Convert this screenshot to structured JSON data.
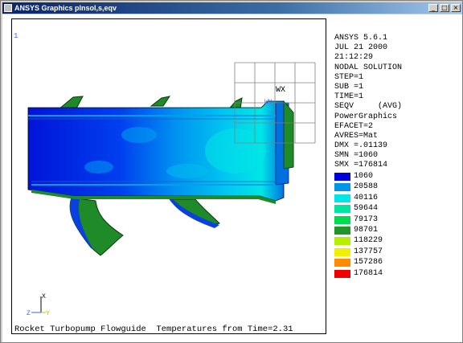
{
  "window": {
    "title": "ANSYS Graphics   plnsol,s,eqv",
    "buttons": {
      "minimize": "_",
      "maximize": "□",
      "close": "×"
    }
  },
  "viewport": {
    "window_number": "1",
    "caption": "Rocket Turbopump Flowguide  Temperatures from Time=2.31",
    "workplane_label": "WX",
    "workplane_label2": "WY"
  },
  "info": [
    "ANSYS 5.6.1",
    "JUL 21 2000",
    "21:12:29",
    "NODAL SOLUTION",
    "STEP=1",
    "SUB =1",
    "TIME=1",
    "SEQV     (AVG)",
    "PowerGraphics",
    "EFACET=2",
    "AVRES=Mat",
    "DMX =.01139",
    "SMN =1060",
    "SMX =176814"
  ],
  "legend": [
    {
      "value": "1060",
      "color": "#0000dc"
    },
    {
      "value": "20588",
      "color": "#0096e6"
    },
    {
      "value": "40116",
      "color": "#00e6e6"
    },
    {
      "value": "59644",
      "color": "#00e6a0"
    },
    {
      "value": "79173",
      "color": "#00dc50"
    },
    {
      "value": "98701",
      "color": "#1e9628"
    },
    {
      "value": "118229",
      "color": "#b4f000"
    },
    {
      "value": "137757",
      "color": "#f0f000"
    },
    {
      "value": "157286",
      "color": "#ff8c00"
    },
    {
      "value": "176814",
      "color": "#f00000"
    }
  ],
  "triad": {
    "x": "X",
    "y": "Y",
    "z": "Z"
  }
}
